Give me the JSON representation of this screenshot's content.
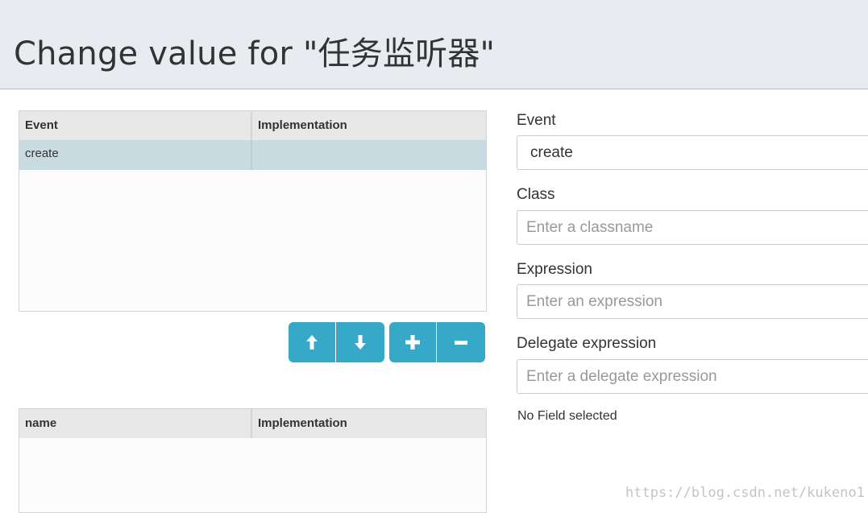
{
  "dialog": {
    "title": "Change value for \"任务监听器\""
  },
  "listeners_grid": {
    "columns": [
      "Event",
      "Implementation"
    ],
    "rows": [
      {
        "event": "create",
        "implementation": ""
      }
    ]
  },
  "toolbar": {
    "buttons": [
      {
        "icon": "arrow-up-icon",
        "label": "Move up"
      },
      {
        "icon": "arrow-down-icon",
        "label": "Move down"
      },
      {
        "icon": "plus-icon",
        "label": "Add"
      },
      {
        "icon": "minus-icon",
        "label": "Remove"
      }
    ],
    "accent_color": "#36a9c8"
  },
  "fields_grid": {
    "columns": [
      "name",
      "Implementation"
    ],
    "rows": []
  },
  "form": {
    "event": {
      "label": "Event",
      "value": "create"
    },
    "class": {
      "label": "Class",
      "placeholder": "Enter a classname"
    },
    "expression": {
      "label": "Expression",
      "placeholder": "Enter an expression"
    },
    "delegate_expression": {
      "label": "Delegate expression",
      "placeholder": "Enter a delegate expression"
    },
    "no_field_text": "No Field selected"
  },
  "watermark": "https://blog.csdn.net/kukeno1"
}
